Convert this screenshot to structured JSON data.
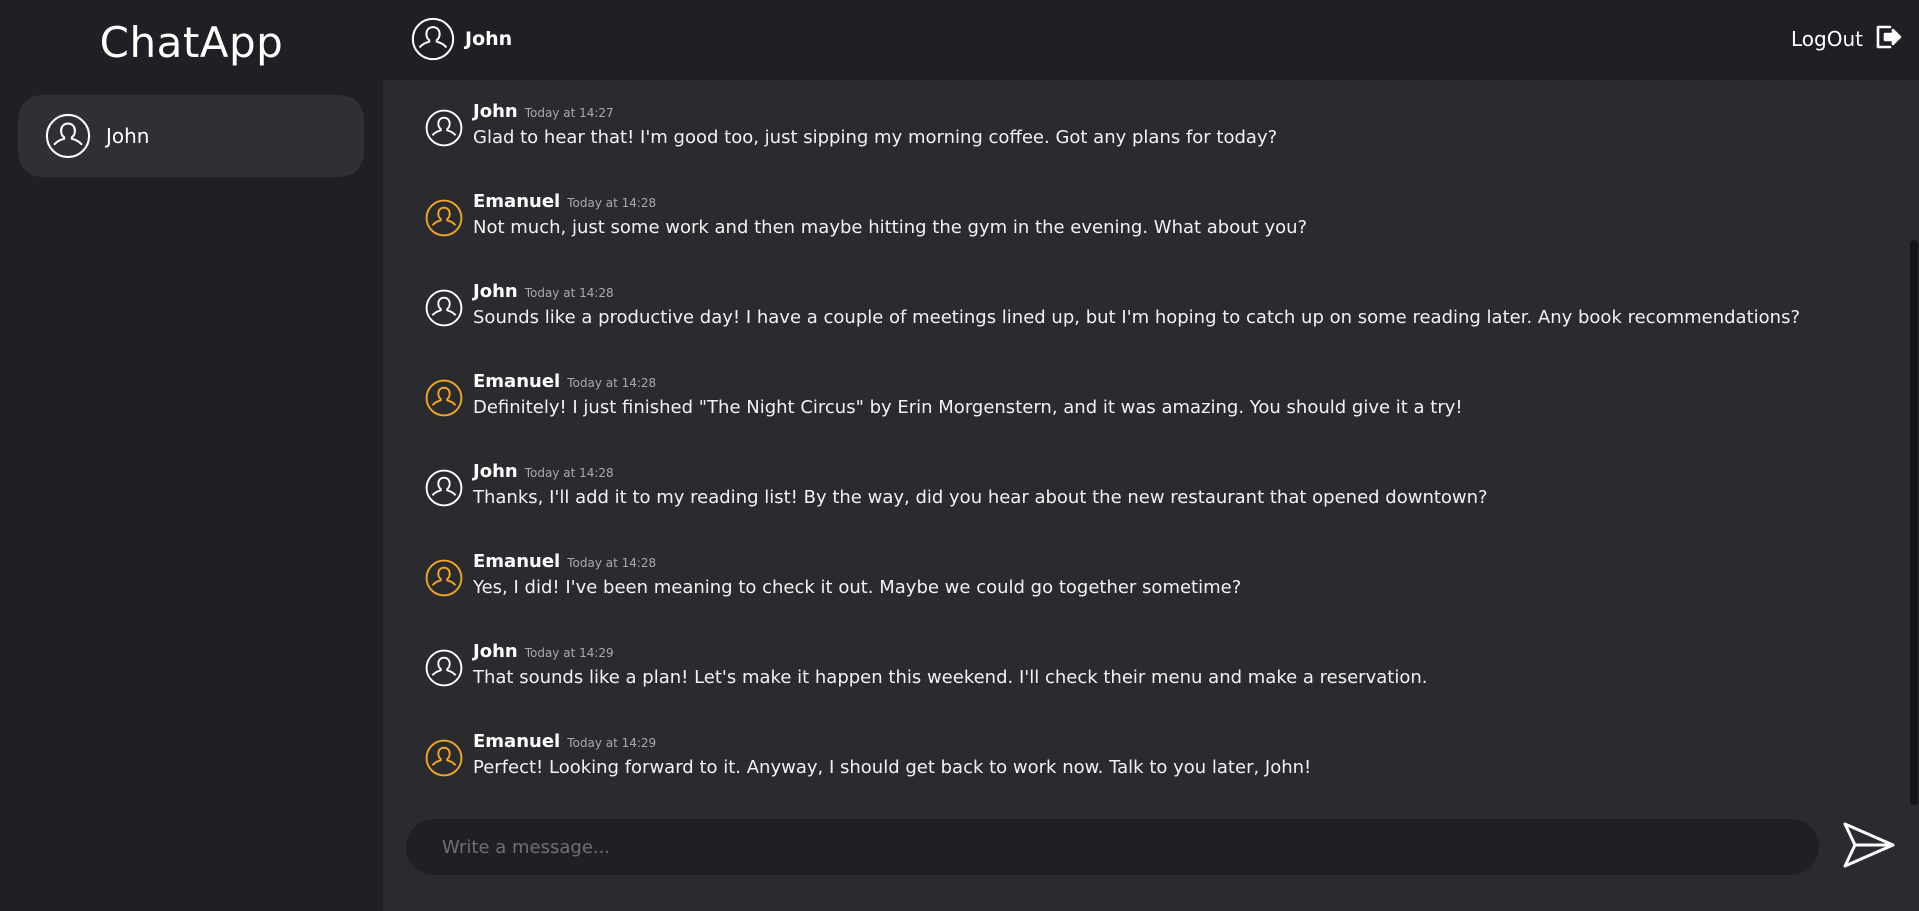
{
  "app": {
    "title": "ChatApp"
  },
  "colors": {
    "self_avatar": "#ffffff",
    "other_avatar": "#f5a623"
  },
  "sidebar": {
    "contacts": [
      {
        "name": "John"
      }
    ]
  },
  "header": {
    "contact_name": "John",
    "logout_label": "LogOut"
  },
  "messages": [
    {
      "author": "John",
      "time": "Today at 14:27",
      "text": "Glad to hear that! I'm good too, just sipping my morning coffee. Got any plans for today?",
      "avatar": "user-icon"
    },
    {
      "author": "Emanuel",
      "time": "Today at 14:28",
      "text": "Not much, just some work and then maybe hitting the gym in the evening. What about you?",
      "avatar": "user-icon"
    },
    {
      "author": "John",
      "time": "Today at 14:28",
      "text": "Sounds like a productive day! I have a couple of meetings lined up, but I'm hoping to catch up on some reading later. Any book recommendations?",
      "avatar": "user-icon"
    },
    {
      "author": "Emanuel",
      "time": "Today at 14:28",
      "text": "Definitely! I just finished \"The Night Circus\" by Erin Morgenstern, and it was amazing. You should give it a try!",
      "avatar": "user-icon"
    },
    {
      "author": "John",
      "time": "Today at 14:28",
      "text": "Thanks, I'll add it to my reading list! By the way, did you hear about the new restaurant that opened downtown?",
      "avatar": "user-icon"
    },
    {
      "author": "Emanuel",
      "time": "Today at 14:28",
      "text": "Yes, I did! I've been meaning to check it out. Maybe we could go together sometime?",
      "avatar": "user-icon"
    },
    {
      "author": "John",
      "time": "Today at 14:29",
      "text": "That sounds like a plan! Let's make it happen this weekend. I'll check their menu and make a reservation.",
      "avatar": "user-icon"
    },
    {
      "author": "Emanuel",
      "time": "Today at 14:29",
      "text": "Perfect! Looking forward to it. Anyway, I should get back to work now. Talk to you later, John!",
      "avatar": "user-icon"
    }
  ],
  "composer": {
    "placeholder": "Write a message...",
    "value": ""
  }
}
